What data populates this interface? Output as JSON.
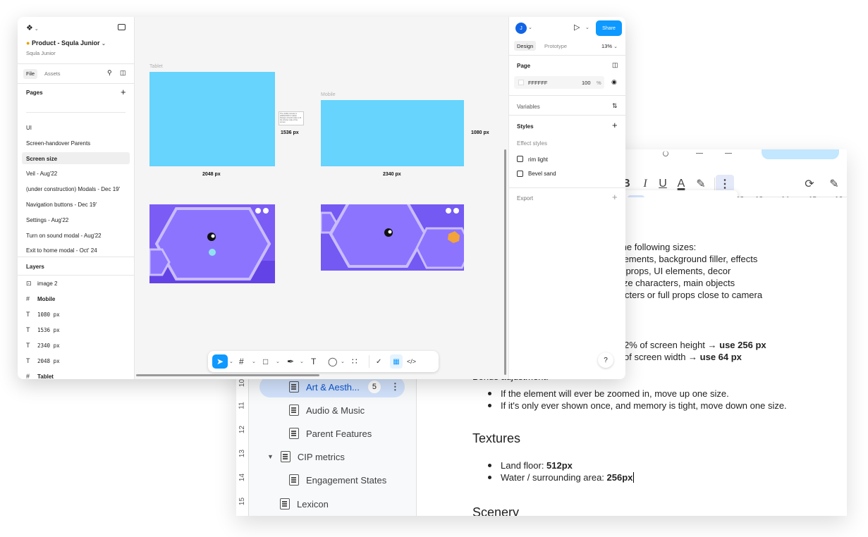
{
  "doc": {
    "toolbar": {
      "bold": "B",
      "italic": "I",
      "underline": "U",
      "text_color": "A"
    },
    "ruler": [
      "12",
      "13",
      "14",
      "15",
      "16"
    ],
    "vruler": [
      "10",
      "11",
      "12",
      "13",
      "14",
      "15"
    ],
    "outline": [
      {
        "label": "Art & Aesth...",
        "badge": "5",
        "active": true
      },
      {
        "label": "Audio & Music"
      },
      {
        "label": "Parent Features"
      },
      {
        "label": "CIP metrics",
        "expandable": true
      },
      {
        "label": "Engagement States"
      },
      {
        "label": "Lexicon"
      }
    ],
    "body": {
      "l1": "de the following sizes:",
      "l2": "nt elements, background filler, effects",
      "l3": "mall props, UI elements, decor",
      "l4": "id-size characters, main objects",
      "l5": "haracters or full props close to camera",
      "l6_a": "2% of screen height → ",
      "l6_b": "use 256 px",
      "l7_a": "of screen width → ",
      "l7_b": "use 64 px",
      "bonus": "Bonus adjustment:",
      "bonus_1": "If the element will ever be zoomed in, move up one size.",
      "bonus_2": "If it's only ever shown once, and memory is tight, move down one size.",
      "textures_title": "Textures",
      "tex_1_a": "Land floor: ",
      "tex_1_b": "512px",
      "tex_2_a": "Water / surrounding area: ",
      "tex_2_b": "256px",
      "scenery_title": "Scenery"
    }
  },
  "figma": {
    "file_name": "Product - Squla Junior",
    "team": "Squla Junior",
    "tabs": {
      "file": "File",
      "assets": "Assets"
    },
    "pages_title": "Pages",
    "pages": [
      "UI",
      "Screen-handover Parents",
      "Screen size",
      "Veil - Aug'22",
      "(under construction) Modals - Dec 19'",
      "Navigation buttons - Dec 19'",
      "Settings - Aug'22",
      "Turn on sound modal - Aug'22",
      "Exit to home modal - Oct' 24"
    ],
    "selected_page": "Screen size",
    "layers_title": "Layers",
    "layers": [
      {
        "icon": "image-icon",
        "glyph": "⊡",
        "label": "image 2"
      },
      {
        "icon": "frame-icon",
        "glyph": "#",
        "label": "Mobile"
      },
      {
        "icon": "text-icon",
        "glyph": "T",
        "label": "1080 px"
      },
      {
        "icon": "text-icon",
        "glyph": "T",
        "label": "1536 px"
      },
      {
        "icon": "text-icon",
        "glyph": "T",
        "label": "2340 px"
      },
      {
        "icon": "text-icon",
        "glyph": "T",
        "label": "2048 px"
      },
      {
        "icon": "frame-icon",
        "glyph": "#",
        "label": "Tablet"
      }
    ],
    "canvas": {
      "tablet_label": "Tablet",
      "mobile_label": "Mobile",
      "tablet_width": "2048 px",
      "tablet_height": "1536 px",
      "mobile_width": "2340 px",
      "mobile_height": "1080 px",
      "note": "The visible canvas is 2048x1536 for tablet. Designs should scale to fit the shorter side of the screen."
    },
    "right": {
      "avatar": "J",
      "share": "Share",
      "design_tab": "Design",
      "prototype_tab": "Prototype",
      "zoom": "13%",
      "page_section": "Page",
      "bg_hex": "FFFFFF",
      "bg_opacity": "100",
      "bg_pct": "%",
      "variables": "Variables",
      "styles": "Styles",
      "effect_styles": "Effect styles",
      "effects": [
        "rim light",
        "Bevel sand"
      ],
      "export": "Export"
    },
    "help": "?"
  },
  "colors": {
    "figma_blue": "#0d99ff",
    "frame_cyan": "#66d4fc",
    "frame_purple": "#7b5cf5",
    "doc_highlight": "#d3e3fd"
  }
}
